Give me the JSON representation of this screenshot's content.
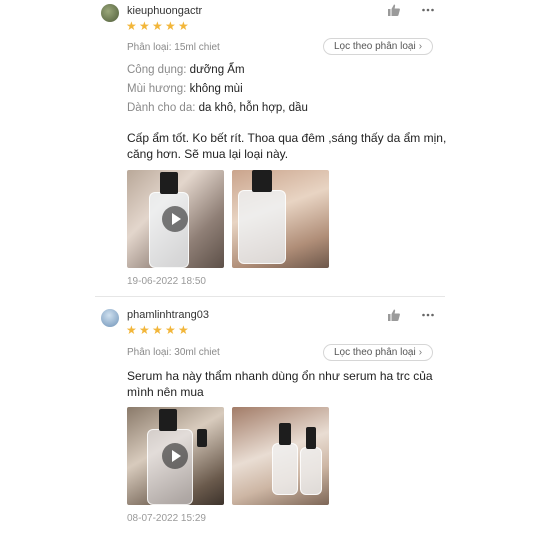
{
  "reviews": [
    {
      "username": "kieuphuongactr",
      "rating": 5,
      "variant_label": "Phân loại: 15ml chiet",
      "filter_label": "Lọc theo phân loại",
      "attributes": [
        {
          "key": "Công dụng:",
          "value": "dưỡng Ẩm"
        },
        {
          "key": "Mùi hương:",
          "value": "không mùi"
        },
        {
          "key": "Dành cho da:",
          "value": "da khô, hỗn hợp, dầu"
        }
      ],
      "comment": "Cấp ẩm tốt. Ko bết rít. Thoa qua đêm ,sáng thấy da ẩm mịn, căng hơn. Sẽ mua lại loại này.",
      "media": [
        {
          "type": "video",
          "icon": "play-icon"
        },
        {
          "type": "photo"
        }
      ],
      "date": "19-06-2022 18:50"
    },
    {
      "username": "phamlinhtrang03",
      "rating": 5,
      "variant_label": "Phân loại: 30ml chiet",
      "filter_label": "Lọc theo phân loại",
      "comment": "Serum ha này thẩm nhanh dùng ổn như serum ha trc của mình nên mua",
      "media": [
        {
          "type": "video",
          "icon": "play-icon"
        },
        {
          "type": "photo"
        }
      ],
      "date": "08-07-2022 15:29"
    }
  ],
  "colors": {
    "star": "#f2b63a",
    "muted_text": "#8a8a8a",
    "date_text": "#9a9a9a"
  },
  "icons": {
    "like": "thumbs-up-icon",
    "more": "more-dots-icon",
    "filter_chevron": "chevron-right-icon"
  }
}
